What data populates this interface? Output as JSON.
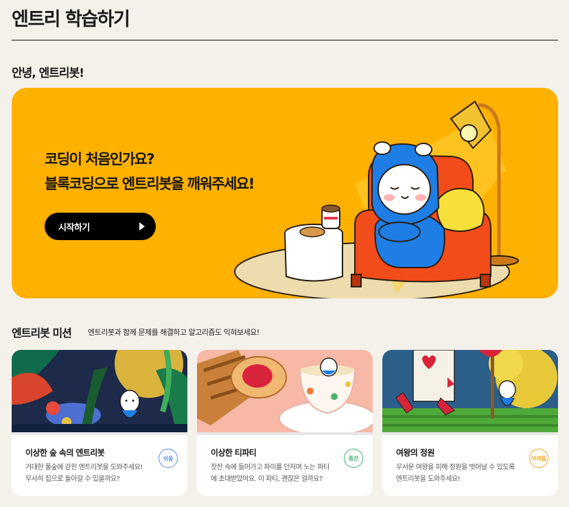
{
  "page": {
    "title": "엔트리 학습하기",
    "greeting": "안녕, 엔트리봇!"
  },
  "hero": {
    "line1": "코딩이 처음인가요?",
    "line2": "블록코딩으로 엔트리봇을 깨워주세요!",
    "button_label": "시작하기",
    "background_color": "#ffb100"
  },
  "missions": {
    "title": "엔트리봇 미션",
    "description": "엔트리봇과 함께 문제를 해결하고 알고리즘도 익혀보세요!",
    "cards": [
      {
        "title": "이상한 숲 속의 엔트리봇",
        "line1": "거대한 풀숲에 갇힌 엔트리봇을 도와주세요!",
        "line2": "무사히 집으로 돌아갈 수 있을까요?",
        "badge": "쉬움",
        "badge_color": "#5b8de0"
      },
      {
        "title": "이상한 티파티",
        "line1": "찻잔 속에 들어가고 파이를 던지며 노는 파티",
        "line2": "에 초대받았어요. 이 파티, 괜찮은 걸까요?",
        "badge": "중간",
        "badge_color": "#3bb36b"
      },
      {
        "title": "여왕의 정원",
        "line1": "무서운 여왕을 피해 정원을 벗어날 수 있도록",
        "line2": "엔트리봇을 도와주세요!",
        "badge": "어려움",
        "badge_color": "#f2a61d"
      }
    ]
  }
}
